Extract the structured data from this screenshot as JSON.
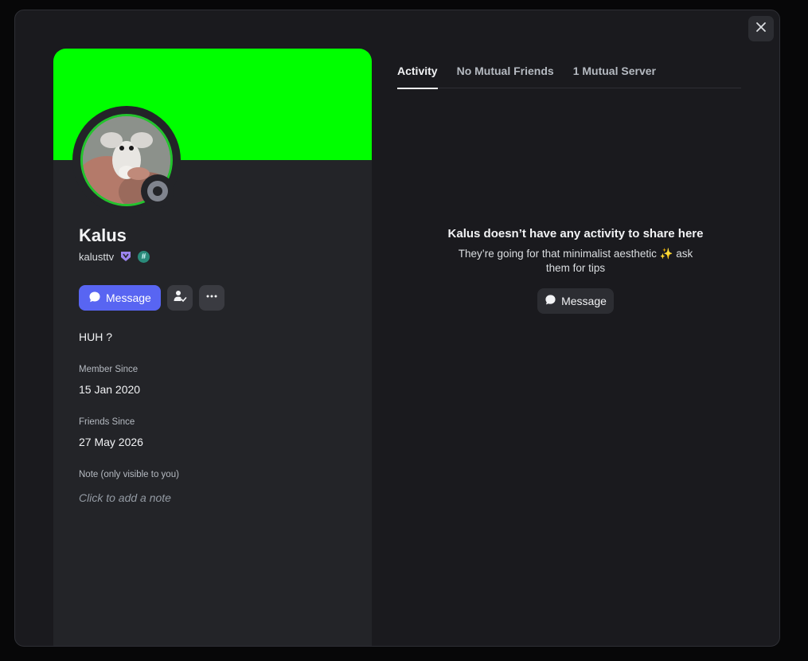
{
  "colors": {
    "banner": "#00ff00",
    "accent": "#5865f2",
    "avatar_ring": "#23c32d",
    "status_offline": "#80848e"
  },
  "profile": {
    "display_name": "Kalus",
    "username": "kalusttv",
    "badges": [
      "hypesquad-icon",
      "hashtag-icon"
    ],
    "status": "offline",
    "message_label": "Message",
    "bio": "HUH ?",
    "member_since_label": "Member Since",
    "member_since": "15 Jan 2020",
    "friends_since_label": "Friends Since",
    "friends_since": "27 May 2026",
    "note_label": "Note (only visible to you)",
    "note_placeholder": "Click to add a note"
  },
  "tabs": [
    {
      "label": "Activity",
      "active": true
    },
    {
      "label": "No Mutual Friends",
      "active": false
    },
    {
      "label": "1 Mutual Server",
      "active": false
    }
  ],
  "activity": {
    "empty_title": "Kalus doesn’t have any activity to share here",
    "empty_subtitle": "They’re going for that minimalist aesthetic ✨ ask them for tips",
    "message_label": "Message"
  }
}
